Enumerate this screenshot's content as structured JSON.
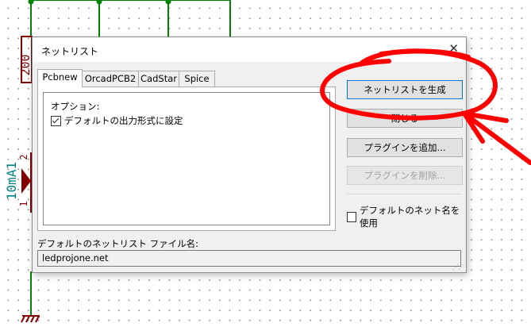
{
  "schematic": {
    "resistor_value": "200",
    "led_reference": "10mA1",
    "led_pin_top": "2",
    "led_pin_bottom": "1",
    "wire_color": "#008400",
    "component_color": "#840000",
    "label_color": "#008484"
  },
  "dialog": {
    "title": "ネットリスト",
    "close_glyph": "✕",
    "tabs": [
      {
        "label": "Pcbnew",
        "active": true
      },
      {
        "label": "OrcadPCB2",
        "active": false
      },
      {
        "label": "CadStar",
        "active": false
      },
      {
        "label": "Spice",
        "active": false
      }
    ],
    "options_label": "オプション:",
    "default_format_checkbox": {
      "label": "デフォルトの出力形式に設定",
      "checked": true
    },
    "buttons": {
      "generate": "ネットリストを生成",
      "close": "閉じる",
      "add_plugin": "プラグインを追加...",
      "remove_plugin": "プラグインを削除..."
    },
    "use_default_net_name": {
      "label": "デフォルトのネット名を使用",
      "checked": false
    },
    "file_label": "デフォルトのネットリスト ファイル名:",
    "file_value": "ledprojone.net"
  },
  "annotation_color": "#ff0000"
}
